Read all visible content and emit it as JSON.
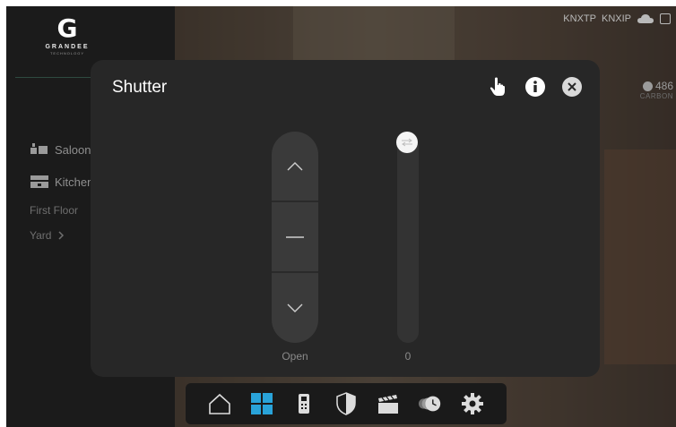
{
  "app": {
    "brand": "GRANDEE",
    "brand_sub": "TECHNOLOGY"
  },
  "topbar": {
    "knx_tp": "KNXTP",
    "knx_ip": "KNXIP",
    "icons": [
      "cloud-icon",
      "screen-icon"
    ]
  },
  "carbon": {
    "value": "486",
    "label": "CARBON"
  },
  "sidebar": {
    "rooms": [
      {
        "label": "Saloon",
        "icon": "saloon-icon"
      },
      {
        "label": "Kitchen",
        "icon": "kitchen-icon"
      }
    ],
    "floors": [
      {
        "label": "First Floor"
      },
      {
        "label": "Yard",
        "has_chevron": true
      }
    ]
  },
  "modal": {
    "title": "Shutter",
    "actions": [
      "hand-pointer-icon",
      "info-icon",
      "close-icon"
    ],
    "control": {
      "state_label": "Open",
      "buttons": [
        "up",
        "stop",
        "down"
      ]
    },
    "slider": {
      "value_label": "0",
      "level": 0
    }
  },
  "dock": {
    "items": [
      "home-icon",
      "grid-icon",
      "intercom-icon",
      "security-shield-icon",
      "scene-clapper-icon",
      "schedule-icon",
      "settings-gear-icon"
    ],
    "active": "grid-icon"
  },
  "colors": {
    "accent": "#29a3d9",
    "modal_bg": "#272727",
    "sidebar_bg": "#1b1b1b"
  }
}
